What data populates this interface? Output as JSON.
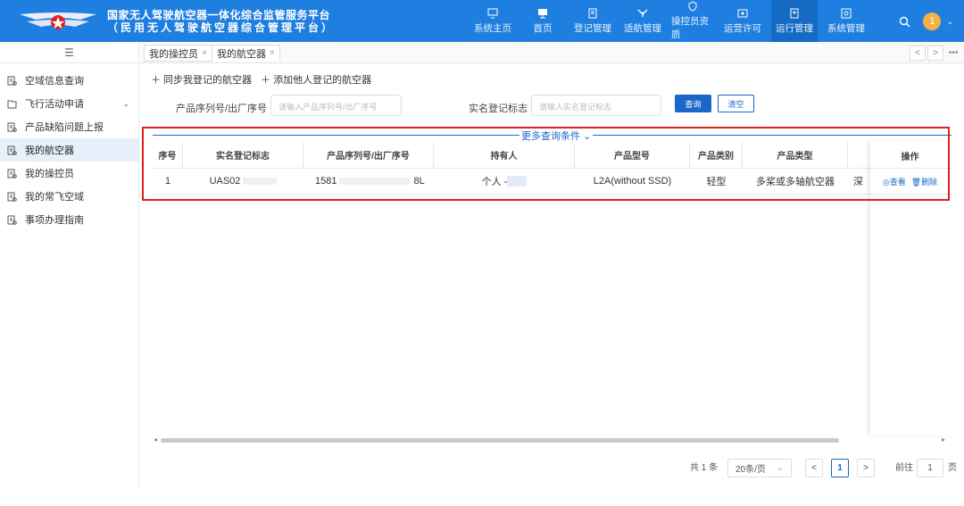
{
  "header": {
    "title_line1": "国家无人驾驶航空器一体化综合监管服务平台",
    "title_line2": "（民用无人驾驶航空器综合管理平台）",
    "nav": [
      {
        "label": "系统主页",
        "icon": "home-icon"
      },
      {
        "label": "首页",
        "icon": "monitor-icon"
      },
      {
        "label": "登记管理",
        "icon": "register-icon"
      },
      {
        "label": "适航管理",
        "icon": "drone-icon"
      },
      {
        "label": "操控员资质",
        "icon": "shield-icon"
      },
      {
        "label": "运营许可",
        "icon": "permit-icon"
      },
      {
        "label": "运行管理",
        "icon": "operation-icon"
      },
      {
        "label": "系统管理",
        "icon": "settings-icon"
      }
    ],
    "active_nav": "运行管理",
    "notification_count": "1",
    "accent_color": "#1e7fe0"
  },
  "sidebar": {
    "items": [
      {
        "label": "空域信息查询",
        "icon": "doc-icon"
      },
      {
        "label": "飞行活动申请",
        "icon": "folder-icon"
      },
      {
        "label": "产品缺陷问题上报",
        "icon": "doc-icon"
      },
      {
        "label": "我的航空器",
        "icon": "doc-icon"
      },
      {
        "label": "我的操控员",
        "icon": "doc-icon"
      },
      {
        "label": "我的常飞空域",
        "icon": "doc-icon"
      },
      {
        "label": "事项办理指南",
        "icon": "doc-icon"
      }
    ],
    "active": "我的航空器"
  },
  "tabs": {
    "items": [
      {
        "label": "我的操控员"
      },
      {
        "label": "我的航空器"
      }
    ],
    "close": "×",
    "prev": "<",
    "next": ">",
    "more": "•••"
  },
  "toolbar": {
    "sync_label": "＋ 同步我登记的航空器",
    "add_label": "＋ 添加他人登记的航空器"
  },
  "filters": {
    "serial_label": "产品序列号/出厂序号",
    "serial_placeholder": "请输入产品序列号/出厂序号",
    "realname_label": "实名登记标志",
    "realname_placeholder": "请输入实名登记标志",
    "search_label": "查询",
    "clear_label": "清空",
    "more_label": "更多查询条件",
    "more_caret": "⌄"
  },
  "table": {
    "columns": [
      "序号",
      "实名登记标志",
      "产品序列号/出厂序号",
      "持有人",
      "产品型号",
      "产品类别",
      "产品类型",
      "操作"
    ],
    "row": {
      "index": "1",
      "reg_prefix": "UAS02",
      "serial_prefix": "1581",
      "serial_suffix": "8L",
      "owner": "个人 - ",
      "model": "L2A(without SSD)",
      "category": "轻型",
      "type": "多桨或多轴航空器",
      "extra": "深",
      "view": "查看",
      "delete": "删除"
    }
  },
  "pagination": {
    "total": "共 1 条",
    "page_size": "20条/页",
    "current_page": "1",
    "goto_label": "前往",
    "goto_value": "1",
    "page_unit": "页"
  }
}
